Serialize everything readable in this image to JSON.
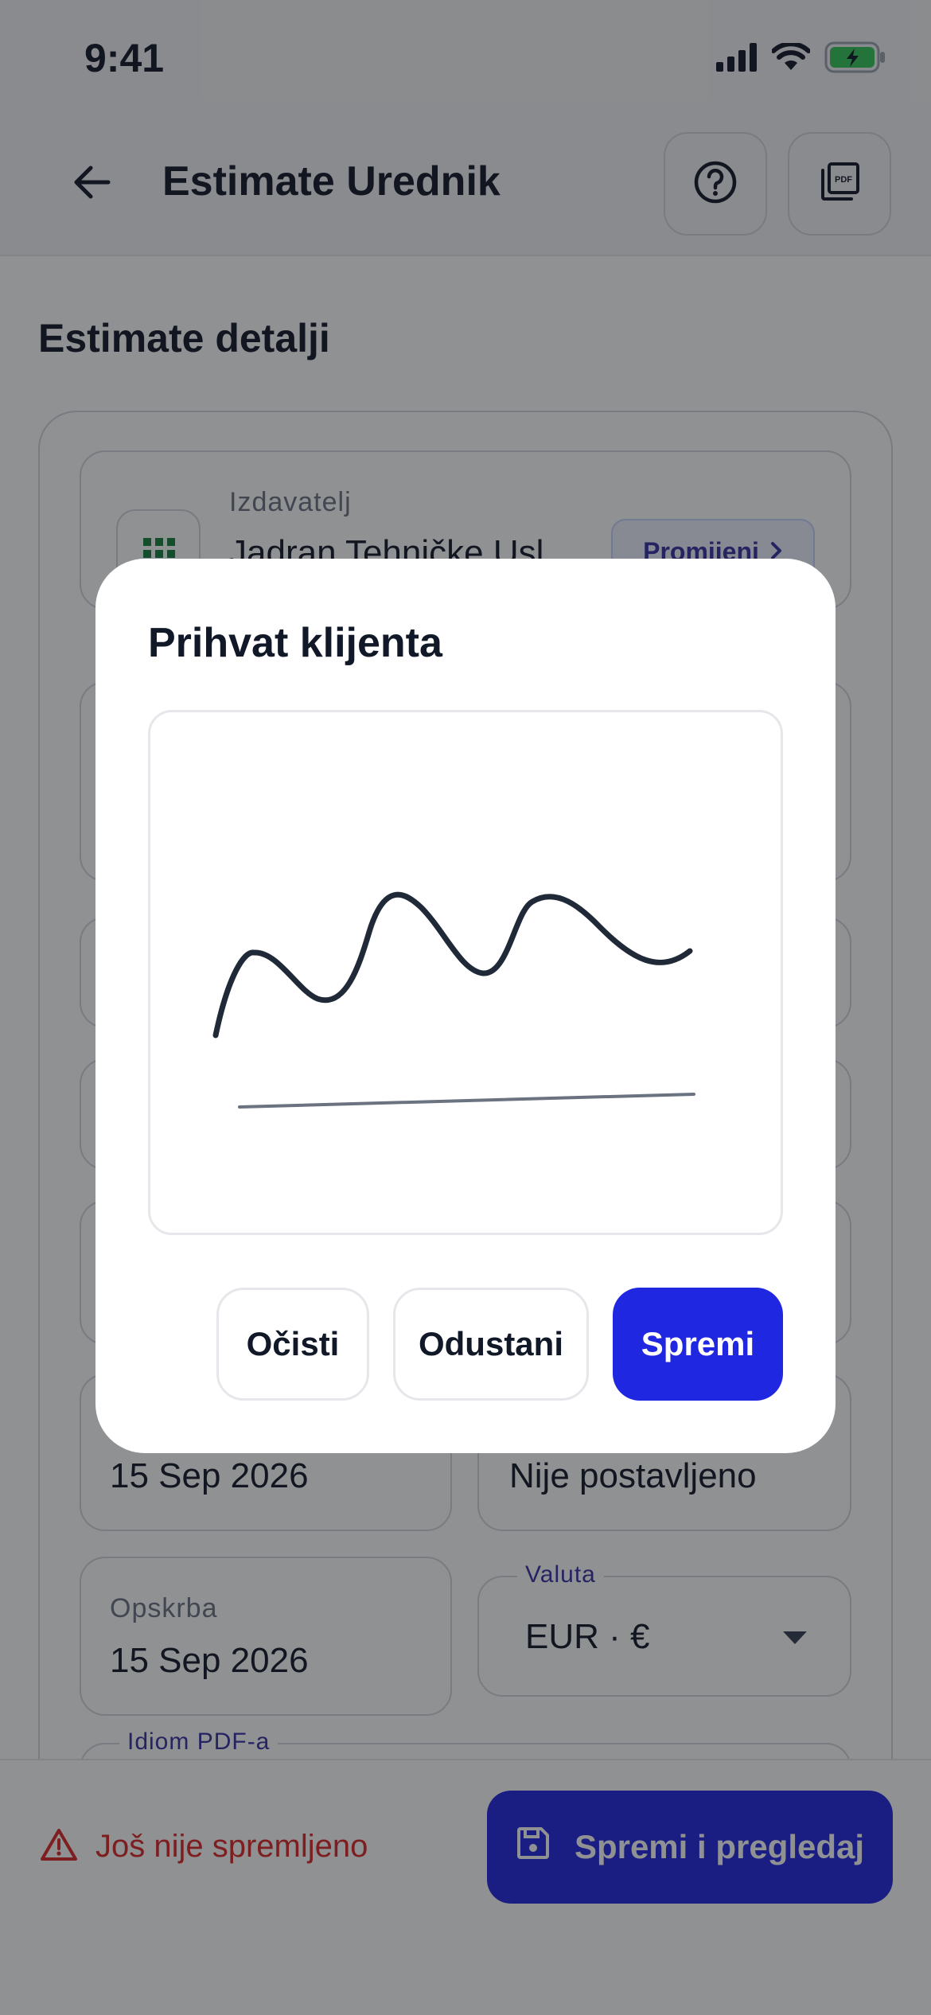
{
  "status_bar": {
    "time": "9:41",
    "icons": [
      "signal-icon",
      "wifi-icon",
      "battery-charging-icon"
    ]
  },
  "header": {
    "title": "Estimate Urednik",
    "back_icon": "arrow-left-icon",
    "help_icon": "question-circle-icon",
    "pdf_icon": "pdf-icon"
  },
  "page": {
    "section_title": "Estimate detalji",
    "issuer": {
      "label": "Izdavatelj",
      "name": "Jadran Tehničke Usl",
      "change_label": "Promijeni"
    },
    "date_left": {
      "value": "15 Sep 2026"
    },
    "date_right": {
      "value": "Nije postavljeno"
    },
    "supply": {
      "label": "Opskrba",
      "value": "15 Sep 2026"
    },
    "currency": {
      "label": "Valuta",
      "value": "EUR · €"
    },
    "pdf_language": {
      "label": "Idiom PDF-a"
    }
  },
  "bottom_bar": {
    "unsaved_text": "Još nije spremljeno",
    "save_view_label": "Spremi i pregledaj"
  },
  "dialog": {
    "title": "Prihvat klijenta",
    "clear_label": "Očisti",
    "cancel_label": "Odustani",
    "save_label": "Spremi"
  },
  "colors": {
    "primary": "#2027e0",
    "warning": "#dc2626",
    "accent_text": "#3730a3"
  }
}
